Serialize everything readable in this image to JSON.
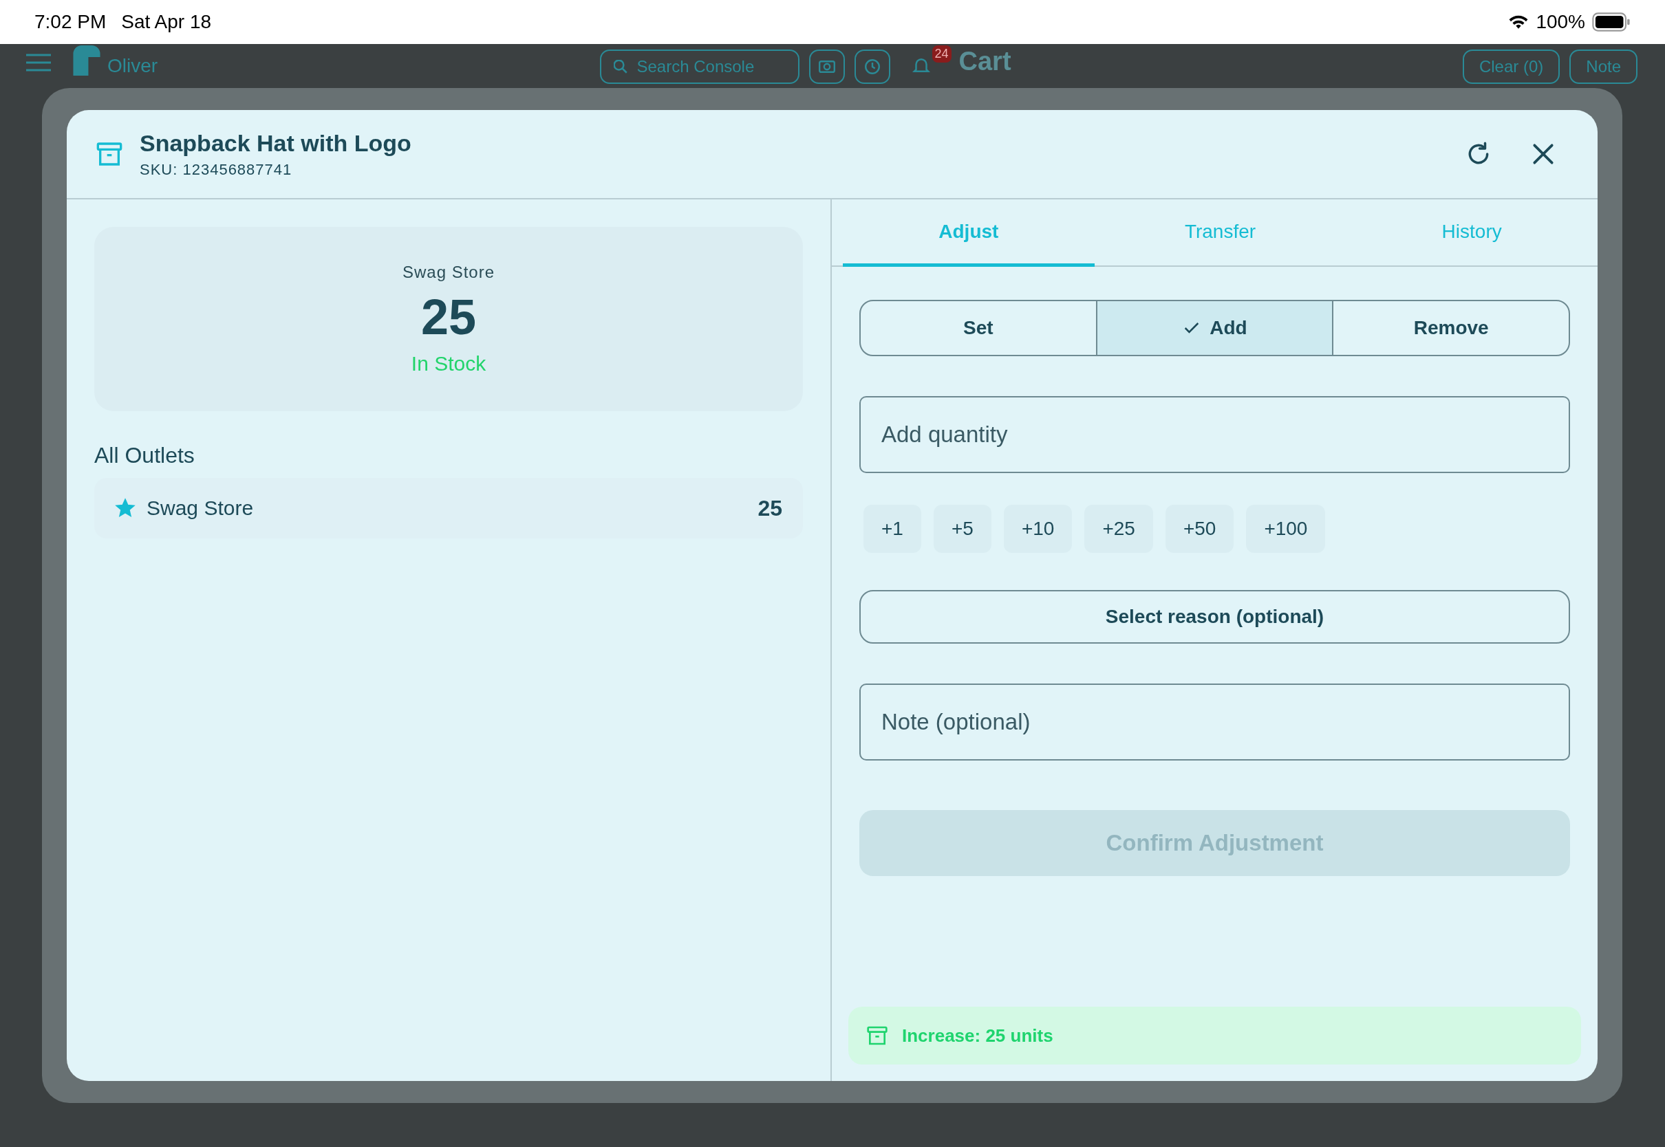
{
  "status_bar": {
    "time": "7:02 PM",
    "date": "Sat Apr 18",
    "battery": "100%"
  },
  "background_app": {
    "brand": "Oliver",
    "search": {
      "placeholder": "Search Console"
    },
    "notification_count": "24",
    "cart_title": "Cart",
    "buttons": [
      "Clear (0)",
      "Note"
    ]
  },
  "modal": {
    "title": "Snapback Hat with Logo",
    "sku": "SKU: 123456887741",
    "stock_card": {
      "outlet": "Swag Store",
      "quantity": "25",
      "status": "In Stock"
    },
    "outlets_heading": "All Outlets",
    "outlets": [
      {
        "name": "Swag Store",
        "quantity": "25",
        "favorite": true
      }
    ],
    "tabs": [
      {
        "label": "Adjust",
        "selected": true
      },
      {
        "label": "Transfer",
        "selected": false
      },
      {
        "label": "History",
        "selected": false
      }
    ],
    "modes": [
      {
        "label": "Set",
        "selected": false
      },
      {
        "label": "Add",
        "selected": true
      },
      {
        "label": "Remove",
        "selected": false
      }
    ],
    "quantity_field": {
      "placeholder": "Add quantity"
    },
    "quick_adds": [
      "+1",
      "+5",
      "+10",
      "+25",
      "+50",
      "+100"
    ],
    "reason_select": {
      "label": "Select reason (optional)"
    },
    "note_field": {
      "placeholder": "Note (optional)"
    },
    "confirm_button": {
      "label": "Confirm Adjustment",
      "disabled": true
    },
    "summary": "Increase: 25 units"
  }
}
